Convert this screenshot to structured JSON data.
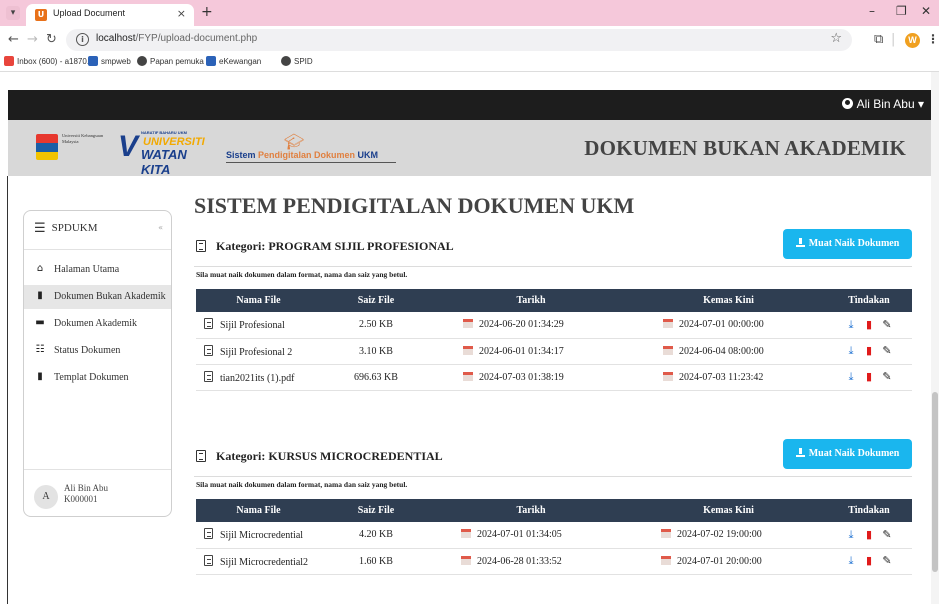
{
  "browser": {
    "tab_title": "Upload Document",
    "tab_close": "×",
    "new_tab": "+",
    "url_host": "localhost",
    "url_path": "/FYP/upload-document.php",
    "bookmarks": [
      "Inbox (600) - a1870...",
      "smpweb",
      "Papan pemuka",
      "eKewangan",
      "SPID"
    ],
    "profile_initial": "W"
  },
  "topbar": {
    "user_name": "Ali Bin Abu ▾"
  },
  "header": {
    "ukm_logo_text": "Universiti Kebangsaan Malaysia",
    "uwk_top": "NARATIF BAHARU UKM",
    "uwk_line1": "UNIVERSITI",
    "uwk_line2": "WATAN KITA",
    "spd_part1": "Sistem ",
    "spd_part2": "Pendigitalan Dokumen",
    "spd_part3": " UKM",
    "title": "DOKUMEN BUKAN AKADEMIK"
  },
  "sidebar": {
    "brand": "SPDUKM",
    "collapse": "«",
    "items": [
      {
        "label": "Halaman Utama",
        "icon": "home-icon"
      },
      {
        "label": "Dokumen Bukan Akademik",
        "icon": "document-icon"
      },
      {
        "label": "Dokumen Akademik",
        "icon": "archive-icon"
      },
      {
        "label": "Status Dokumen",
        "icon": "list-check-icon"
      },
      {
        "label": "Templat Dokumen",
        "icon": "clipboard-icon"
      }
    ],
    "user_initial": "A",
    "user_name": "Ali Bin Abu",
    "user_id": "K000001"
  },
  "main": {
    "title": "SISTEM PENDIGITALAN DOKUMEN UKM",
    "upload_label": "Muat Naik Dokumen",
    "note": "Sila muat naik dokumen dalam format, nama dan saiz yang betul.",
    "columns": [
      "Nama File",
      "Saiz File",
      "Tarikh",
      "Kemas Kini",
      "Tindakan"
    ],
    "sections": [
      {
        "category": "Kategori: PROGRAM SIJIL PROFESIONAL",
        "rows": [
          {
            "name": "Sijil Profesional",
            "size": "2.50 KB",
            "date": "2024-06-20 01:34:29",
            "updated": "2024-07-01 00:00:00"
          },
          {
            "name": "Sijil Profesional 2",
            "size": "3.10 KB",
            "date": "2024-06-01 01:34:17",
            "updated": "2024-06-04 08:00:00"
          },
          {
            "name": "tian2021its (1).pdf",
            "size": "696.63 KB",
            "date": "2024-07-03 01:38:19",
            "updated": "2024-07-03 11:23:42"
          }
        ]
      },
      {
        "category": "Kategori: KURSUS MICROCREDENTIAL",
        "rows": [
          {
            "name": "Sijil Microcredential",
            "size": "4.20 KB",
            "date": "2024-07-01 01:34:05",
            "updated": "2024-07-02 19:00:00"
          },
          {
            "name": "Sijil Microcredential2",
            "size": "1.60 KB",
            "date": "2024-06-28 01:33:52",
            "updated": "2024-07-01 20:00:00"
          }
        ]
      }
    ]
  }
}
